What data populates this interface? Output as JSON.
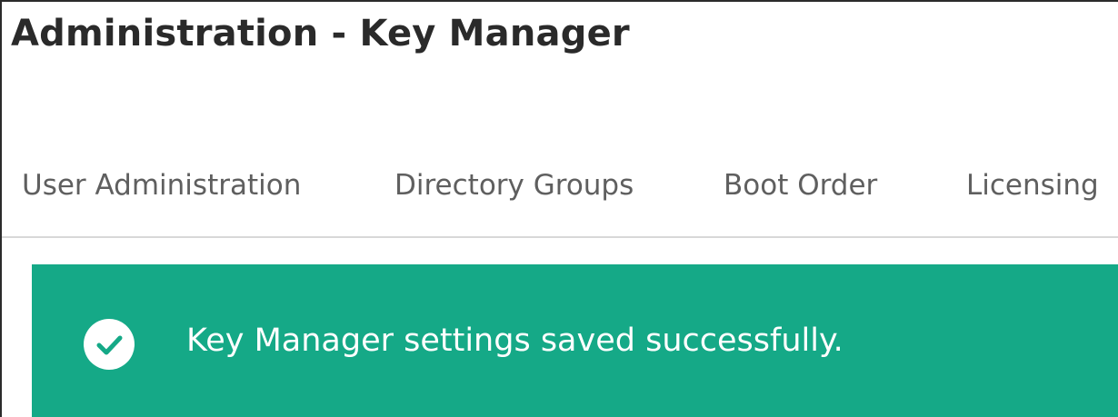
{
  "page": {
    "title": "Administration - Key Manager"
  },
  "tabs": [
    {
      "label": "User Administration"
    },
    {
      "label": "Directory Groups"
    },
    {
      "label": "Boot Order"
    },
    {
      "label": "Licensing"
    }
  ],
  "alert": {
    "message": "Key Manager settings saved successfully.",
    "icon": "check-circle-icon",
    "background_color": "#15a987"
  }
}
